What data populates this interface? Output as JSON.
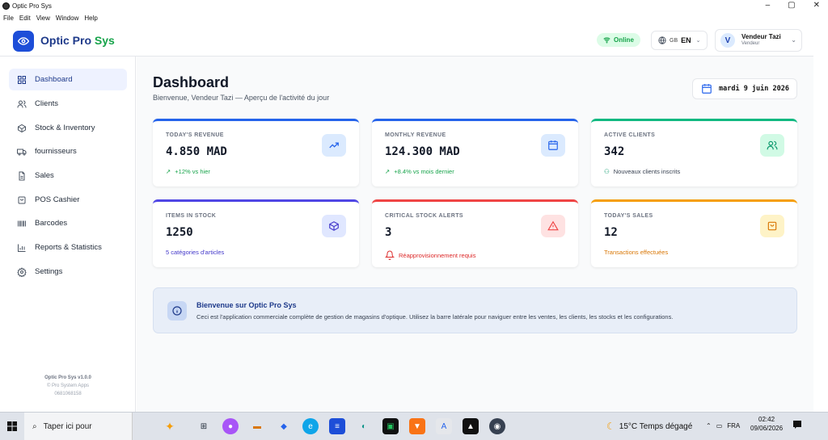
{
  "window": {
    "title": "Optic Pro Sys",
    "controls": [
      "–",
      "▢",
      "✕"
    ]
  },
  "menubar": [
    "File",
    "Edit",
    "View",
    "Window",
    "Help"
  ],
  "header": {
    "brand_main": "Optic Pro",
    "brand_accent": "Sys",
    "status": "Online",
    "language_flag": "GB",
    "language": "EN",
    "user_initial": "V",
    "user_name": "Vendeur Tazi",
    "user_role": "Vendeur"
  },
  "sidebar": {
    "items": [
      {
        "label": "Dashboard",
        "icon": "grid-icon",
        "active": true
      },
      {
        "label": "Clients",
        "icon": "users-icon"
      },
      {
        "label": "Stock & Inventory",
        "icon": "box-icon"
      },
      {
        "label": "fournisseurs",
        "icon": "truck-icon"
      },
      {
        "label": "Sales",
        "icon": "file-icon"
      },
      {
        "label": "POS Cashier",
        "icon": "cart-icon"
      },
      {
        "label": "Barcodes",
        "icon": "barcode-icon"
      },
      {
        "label": "Reports & Statistics",
        "icon": "chart-icon"
      },
      {
        "label": "Settings",
        "icon": "gear-icon"
      }
    ],
    "footer": {
      "version": "Optic Pro Sys v1.0.0",
      "company": "© Pro System Apps",
      "code": "0681068158"
    }
  },
  "main": {
    "title": "Dashboard",
    "subtitle": "Bienvenue, Vendeur Tazi — Aperçu de l'activité du jour",
    "date": "mardi 9 juin 2026",
    "cards": [
      {
        "label": "TODAY'S REVENUE",
        "value": "4.850 MAD",
        "foot": "+12% vs hier",
        "accent": "#2563eb",
        "foot_color": "#16a34a",
        "icon": "trending-up-icon",
        "icon_bg": "#dbeafe",
        "icon_color": "#2563eb"
      },
      {
        "label": "MONTHLY REVENUE",
        "value": "124.300 MAD",
        "foot": "+8.4% vs mois dernier",
        "accent": "#2563eb",
        "foot_color": "#16a34a",
        "icon": "calendar-icon",
        "icon_bg": "#dbeafe",
        "icon_color": "#2563eb"
      },
      {
        "label": "ACTIVE CLIENTS",
        "value": "342",
        "foot": "Nouveaux clients inscrits",
        "accent": "#10b981",
        "foot_color": "#374151",
        "icon": "users-icon",
        "icon_bg": "#d1fae5",
        "icon_color": "#059669"
      },
      {
        "label": "ITEMS IN STOCK",
        "value": "1250",
        "foot": "5 catégories d'articles",
        "accent": "#4f46e5",
        "foot_color": "#4338ca",
        "icon": "box-icon",
        "icon_bg": "#e0e7ff",
        "icon_color": "#4338ca"
      },
      {
        "label": "CRITICAL STOCK ALERTS",
        "value": "3",
        "foot": "Réapprovisionnement requis",
        "accent": "#ef4444",
        "foot_color": "#dc2626",
        "icon": "alert-triangle-icon",
        "icon_bg": "#fee2e2",
        "icon_color": "#ef4444"
      },
      {
        "label": "TODAY'S SALES",
        "value": "12",
        "foot": "Transactions effectuées",
        "accent": "#f59e0b",
        "foot_color": "#d97706",
        "icon": "shopping-bag-icon",
        "icon_bg": "#fef3c7",
        "icon_color": "#d97706"
      }
    ],
    "banner": {
      "title": "Bienvenue sur Optic Pro Sys",
      "text": "Ceci est l'application commerciale complète de gestion de magasins d'optique. Utilisez la barre latérale pour naviguer entre les ventes, les clients, les stocks et les configurations."
    }
  },
  "taskbar": {
    "search_placeholder": "Taper ici pour",
    "weather": "15°C Temps dégagé",
    "lang": "FRA",
    "time": "02:42",
    "date": "09/06/2026"
  }
}
